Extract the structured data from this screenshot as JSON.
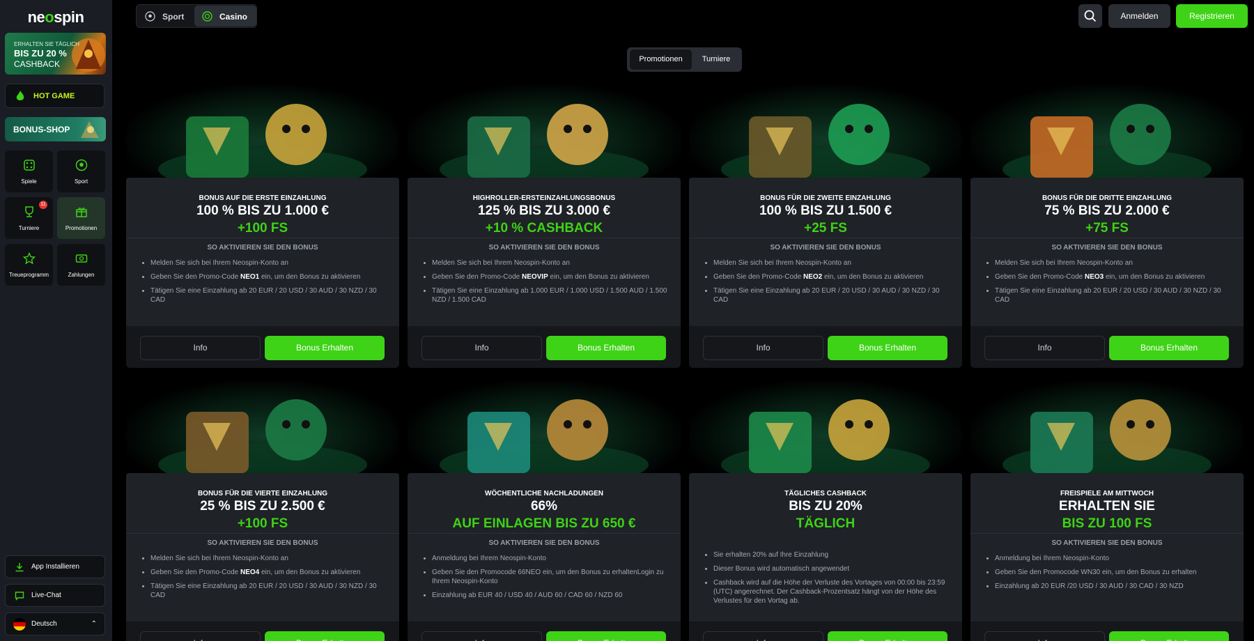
{
  "brand": {
    "logo_text_a": "ne",
    "logo_text_o": "o",
    "logo_text_b": "spin"
  },
  "sidebar": {
    "cashback_banner": {
      "line1": "ERHALTEN SIE TÄGLICH",
      "line2": "BIS ZU 20 %",
      "line3": "CASHBACK"
    },
    "hot_game": "HOT GAME",
    "bonus_shop": "BONUS-SHOP",
    "tiles": [
      {
        "label": "Spiele",
        "icon": "dice-icon"
      },
      {
        "label": "Sport",
        "icon": "soccer-ball-icon"
      },
      {
        "label": "Turniere",
        "icon": "trophy-icon",
        "badge": "11"
      },
      {
        "label": "Promotionen",
        "icon": "gift-icon"
      },
      {
        "label": "Treueprogramm",
        "icon": "star-icon"
      },
      {
        "label": "Zahlungen",
        "icon": "money-icon"
      }
    ],
    "app_install": "App Installieren",
    "live_chat": "Live-Chat",
    "language": "Deutsch"
  },
  "topbar": {
    "sport": "Sport",
    "casino": "Casino",
    "login": "Anmelden",
    "register": "Registrieren"
  },
  "tabs": {
    "promotions": "Promotionen",
    "tournaments": "Turniere"
  },
  "common": {
    "activate": "SO AKTIVIEREN SIE DEN BONUS",
    "info": "Info",
    "get_bonus": "Bonus Erhalten"
  },
  "cards": [
    {
      "subtitle": "BONUS AUF DIE ERSTE EINZAHLUNG",
      "headline": "100 % BIS ZU 1.000 €",
      "green": "+100 FS",
      "steps": [
        {
          "pre": "Melden Sie sich bei Ihrem Neospin-Konto an",
          "code": "",
          "post": ""
        },
        {
          "pre": "Geben Sie den Promo-Code ",
          "code": "NEO1",
          "post": " ein, um den Bonus zu aktivieren"
        },
        {
          "pre": "Tätigen Sie eine Einzahlung ab 20 EUR / 20 USD / 30 AUD / 30 NZD / 30 CAD",
          "code": "",
          "post": ""
        }
      ]
    },
    {
      "subtitle": "HIGHROLLER-ERSTEINZAHLUNGSBONUS",
      "headline": "125 % BIS ZU 3.000 €",
      "green": "+10 % CASHBACK",
      "steps": [
        {
          "pre": "Melden Sie sich bei Ihrem Neospin-Konto an",
          "code": "",
          "post": ""
        },
        {
          "pre": "Geben Sie den Promo-Code ",
          "code": "NEOVIP",
          "post": " ein, um den Bonus zu aktivieren"
        },
        {
          "pre": "Tätigen Sie eine Einzahlung ab 1.000 EUR / 1.000 USD / 1.500 AUD / 1.500 NZD / 1.500 CAD",
          "code": "",
          "post": ""
        }
      ]
    },
    {
      "subtitle": "BONUS FÜR DIE ZWEITE EINZAHLUNG",
      "headline": "100 % BIS ZU 1.500 €",
      "green": "+25 FS",
      "steps": [
        {
          "pre": "Melden Sie sich bei Ihrem Neospin-Konto an",
          "code": "",
          "post": ""
        },
        {
          "pre": "Geben Sie den Promo-Code ",
          "code": "NEO2",
          "post": " ein, um den Bonus zu aktivieren"
        },
        {
          "pre": "Tätigen Sie eine Einzahlung ab 20 EUR / 20 USD / 30 AUD / 30 NZD / 30 CAD",
          "code": "",
          "post": ""
        }
      ]
    },
    {
      "subtitle": "BONUS FÜR DIE DRITTE EINZAHLUNG",
      "headline": "75 % BIS ZU 2.000 €",
      "green": "+75 FS",
      "steps": [
        {
          "pre": "Melden Sie sich bei Ihrem Neospin-Konto an",
          "code": "",
          "post": ""
        },
        {
          "pre": "Geben Sie den Promo-Code ",
          "code": "NEO3",
          "post": " ein, um den Bonus zu aktivieren"
        },
        {
          "pre": "Tätigen Sie eine Einzahlung ab 20 EUR / 20 USD / 30 AUD / 30 NZD / 30 CAD",
          "code": "",
          "post": ""
        }
      ]
    },
    {
      "subtitle": "BONUS FÜR DIE VIERTE EINZAHLUNG",
      "headline": "25 % BIS ZU 2.500 €",
      "green": "+100 FS",
      "steps": [
        {
          "pre": "Melden Sie sich bei Ihrem Neospin-Konto an",
          "code": "",
          "post": ""
        },
        {
          "pre": "Geben Sie den Promo-Code ",
          "code": "NEO4",
          "post": " ein, um den Bonus zu aktivieren"
        },
        {
          "pre": "Tätigen Sie eine Einzahlung ab 20 EUR / 20 USD / 30 AUD / 30 NZD / 30 CAD",
          "code": "",
          "post": ""
        }
      ]
    },
    {
      "subtitle": "WÖCHENTLICHE NACHLADUNGEN",
      "headline": "66%",
      "green": "AUF EINLAGEN BIS ZU 650 €",
      "steps": [
        {
          "pre": "Anmeldung bei Ihrem Neospin-Konto",
          "code": "",
          "post": ""
        },
        {
          "pre": "Geben Sie den Promocode 66NEO ein, um den Bonus zu erhaltenLogin zu Ihrem Neospin-Konto",
          "code": "",
          "post": ""
        },
        {
          "pre": "Einzahlung ab EUR 40 / USD 40 / AUD 60 / CAD 60 / NZD 60",
          "code": "",
          "post": ""
        }
      ]
    },
    {
      "subtitle": "TÄGLICHES CASHBACK",
      "headline": "BIS ZU 20%",
      "green": "TÄGLICH",
      "steps": [
        {
          "pre": "Sie erhalten 20% auf Ihre Einzahlung",
          "code": "",
          "post": ""
        },
        {
          "pre": "Dieser Bonus wird automatisch angewendet",
          "code": "",
          "post": ""
        },
        {
          "pre": "Cashback wird auf die Höhe der Verluste des Vortages von 00:00 bis 23:59 (UTC) angerechnet. Der Cashback-Prozentsatz hängt von der Höhe des Verlustes für den Vortag ab.",
          "code": "",
          "post": ""
        }
      ]
    },
    {
      "subtitle": "FREISPIELE AM MITTWOCH",
      "headline": "ERHALTEN SIE",
      "green": "BIS ZU 100 FS",
      "steps": [
        {
          "pre": "Anmeldung bei Ihrem Neospin-Konto",
          "code": "",
          "post": ""
        },
        {
          "pre": "Geben Sie den Promocode WN30 ein, um den Bonus zu erhalten",
          "code": "",
          "post": ""
        },
        {
          "pre": "Einzahlung ab 20 EUR /20 USD / 30 AUD / 30 CAD / 30 NZD",
          "code": "",
          "post": ""
        }
      ]
    }
  ],
  "colors": {
    "accent": "#3ed316",
    "panel": "#1f2227",
    "sidebar": "#1a1d23",
    "hot": "#c5f51c"
  }
}
